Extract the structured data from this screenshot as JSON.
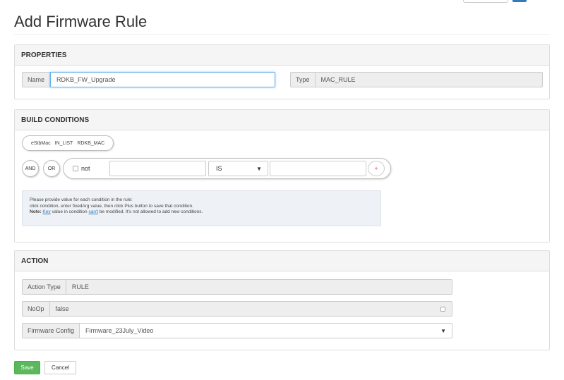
{
  "page": {
    "title": "Add Firmware Rule"
  },
  "properties": {
    "heading": "PROPERTIES",
    "name_label": "Name",
    "name_value": "RDKB_FW_Upgrade",
    "type_label": "Type",
    "type_value": "MAC_RULE"
  },
  "build_conditions": {
    "heading": "BUILD CONDITIONS",
    "condition": {
      "key": "eStbMac",
      "operation": "IN_LIST",
      "value": "RDKB_MAC"
    },
    "and_label": "AND",
    "or_label": "OR",
    "not_label": "not",
    "operation_selected": "IS",
    "plus_label": "+",
    "info": {
      "line1": "Please provide value for each condition in the rule:",
      "line2": "click condition, enter fixedArg value, then click Plus button to save that condition.",
      "note_label": "Note:",
      "note_key": "Key",
      "note_mid": "value in condition",
      "note_cant": "can't",
      "note_rest": "be modified. It's not allowed to add new conditions."
    }
  },
  "action": {
    "heading": "ACTION",
    "action_type_label": "Action Type",
    "action_type_value": "RULE",
    "noop_label": "NoOp",
    "noop_value": "false",
    "firmware_config_label": "Firmware Config",
    "firmware_config_value": "Firmware_23July_Video"
  },
  "buttons": {
    "save": "Save",
    "cancel": "Cancel"
  },
  "colors": {
    "save_green": "#5cb85c",
    "focus_blue": "#66afe9",
    "plus_red": "#d9534f"
  },
  "icons": {
    "select_caret": "triangle-down",
    "plus": "plus"
  }
}
